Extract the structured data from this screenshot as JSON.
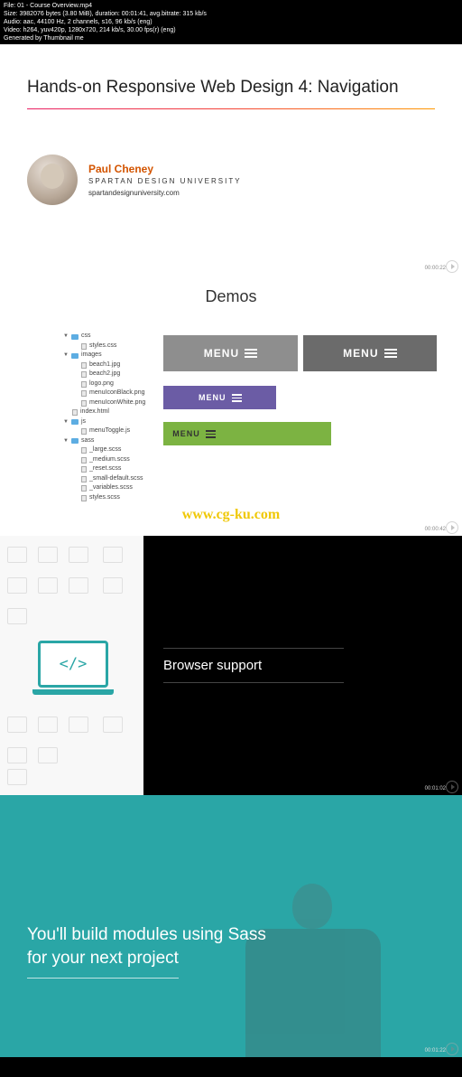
{
  "meta": {
    "file": "File: 01 - Course Overview.mp4",
    "size": "Size: 3982076 bytes (3.80 MiB), duration: 00:01:41, avg.bitrate: 315 kb/s",
    "audio": "Audio: aac, 44100 Hz, 2 channels, s16, 96 kb/s (eng)",
    "video": "Video: h264, yuv420p, 1280x720, 214 kb/s, 30.00 fps(r) (eng)",
    "gen": "Generated by Thumbnail me"
  },
  "panel1": {
    "title": "Hands-on Responsive Web Design 4: Navigation",
    "author_name": "Paul Cheney",
    "author_org": "SPARTAN DESIGN UNIVERSITY",
    "author_url": "spartandesignuniversity.com",
    "timestamp": "00:00:22"
  },
  "panel2": {
    "title": "Demos",
    "timestamp": "00:00:42",
    "watermark": "www.cg-ku.com",
    "tree": {
      "css": "css",
      "styles_css": "styles.css",
      "images": "images",
      "beach1": "beach1.jpg",
      "beach2": "beach2.jpg",
      "logo": "logo.png",
      "menu_black": "menuIconBlack.png",
      "menu_white": "menuIconWhite.png",
      "index": "index.html",
      "js": "js",
      "menutoggle": "menuToggle.js",
      "sass": "sass",
      "large": "_large.scss",
      "medium": "_medium.scss",
      "reset": "_reset.scss",
      "small": "_small-default.scss",
      "variables": "_variables.scss",
      "styles_scss": "styles.scss"
    },
    "menus": {
      "m1": "MENU",
      "m2": "MENU",
      "m3": "MENU",
      "m4": "MENU"
    }
  },
  "panel3": {
    "title": "Browser support",
    "laptop": "</>",
    "timestamp": "00:01:02"
  },
  "panel4": {
    "line1": "You'll build modules using Sass",
    "line2": "for your next project",
    "timestamp": "00:01:22"
  }
}
